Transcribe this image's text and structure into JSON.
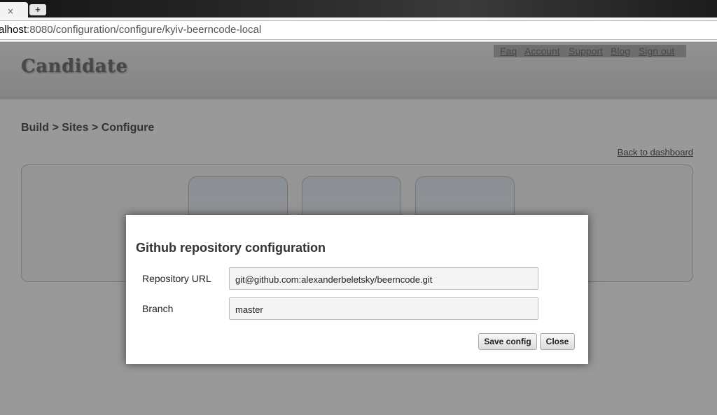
{
  "browser": {
    "tab_close_glyph": "×",
    "new_tab_glyph": "+",
    "url_host": "alhost",
    "url_path": ":8080/configuration/configure/kyiv-beerncode-local"
  },
  "header": {
    "logo": "Candidate",
    "nav": [
      "Faq",
      "Account",
      "Support",
      "Blog",
      "Sign out"
    ]
  },
  "breadcrumb": "Build > Sites > Configure",
  "back_link": "Back to dashboard",
  "modal": {
    "title": "Github repository configuration",
    "fields": {
      "repo_url": {
        "label": "Repository URL",
        "value": "git@github.com:alexanderbeletsky/beerncode.git"
      },
      "branch": {
        "label": "Branch",
        "value": "master"
      }
    },
    "buttons": {
      "save": "Save config",
      "close": "Close"
    }
  }
}
